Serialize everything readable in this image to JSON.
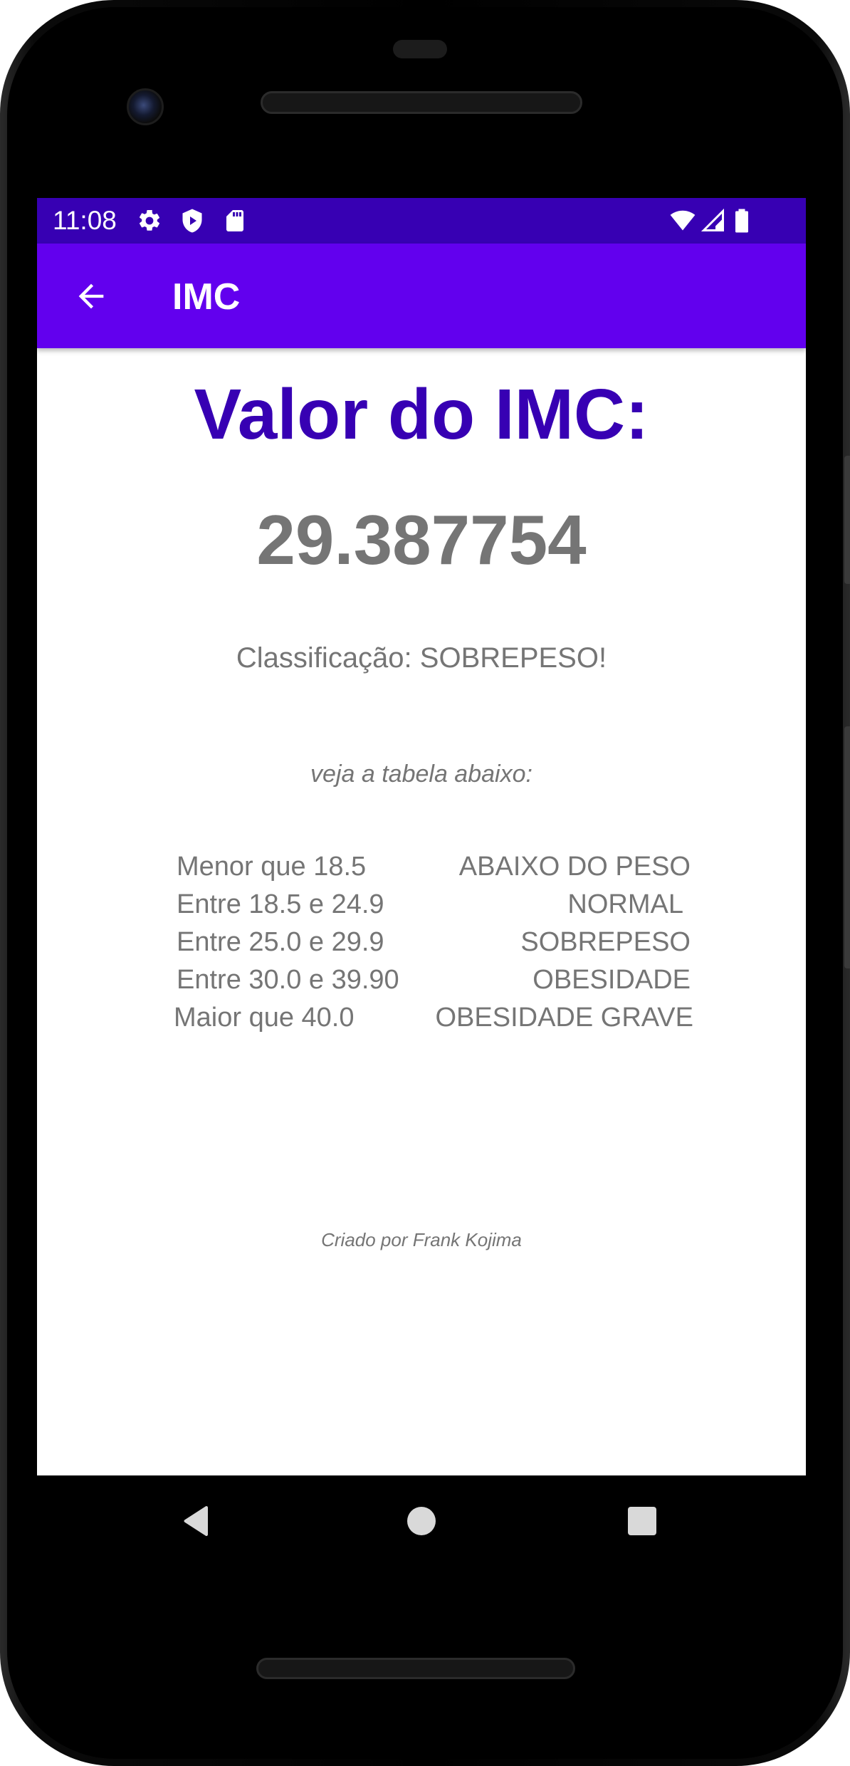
{
  "status_bar": {
    "time": "11:08",
    "left_icons": [
      "settings-icon",
      "shield-icon",
      "sd-card-icon"
    ],
    "right_icons": [
      "wifi-icon",
      "cellular-signal-icon",
      "battery-icon"
    ]
  },
  "app_bar": {
    "back_icon": "arrow-back-icon",
    "title": "IMC"
  },
  "result": {
    "title": "Valor do IMC:",
    "value": "29.387754",
    "classification": "Classificação: SOBREPESO!"
  },
  "table_hint": "veja a tabela abaixo:",
  "bmi_table": [
    {
      "range": "Menor que 18.5",
      "classification": "ABAIXO DO PESO"
    },
    {
      "range": "Entre 18.5 e 24.9",
      "classification": "NORMAL"
    },
    {
      "range": "Entre 25.0 e 29.9",
      "classification": "SOBREPESO"
    },
    {
      "range": "Entre 30.0 e 39.90",
      "classification": "OBESIDADE"
    },
    {
      "range": "Maior que 40.0",
      "classification": "OBESIDADE GRAVE"
    }
  ],
  "credits": "Criado por Frank Kojima",
  "nav_bar": [
    "back-triangle-icon",
    "home-circle-icon",
    "recents-square-icon"
  ],
  "colors": {
    "status_bar": "#3700B3",
    "app_bar": "#6200EE",
    "title_text": "#3700B3",
    "body_text": "#757575"
  }
}
